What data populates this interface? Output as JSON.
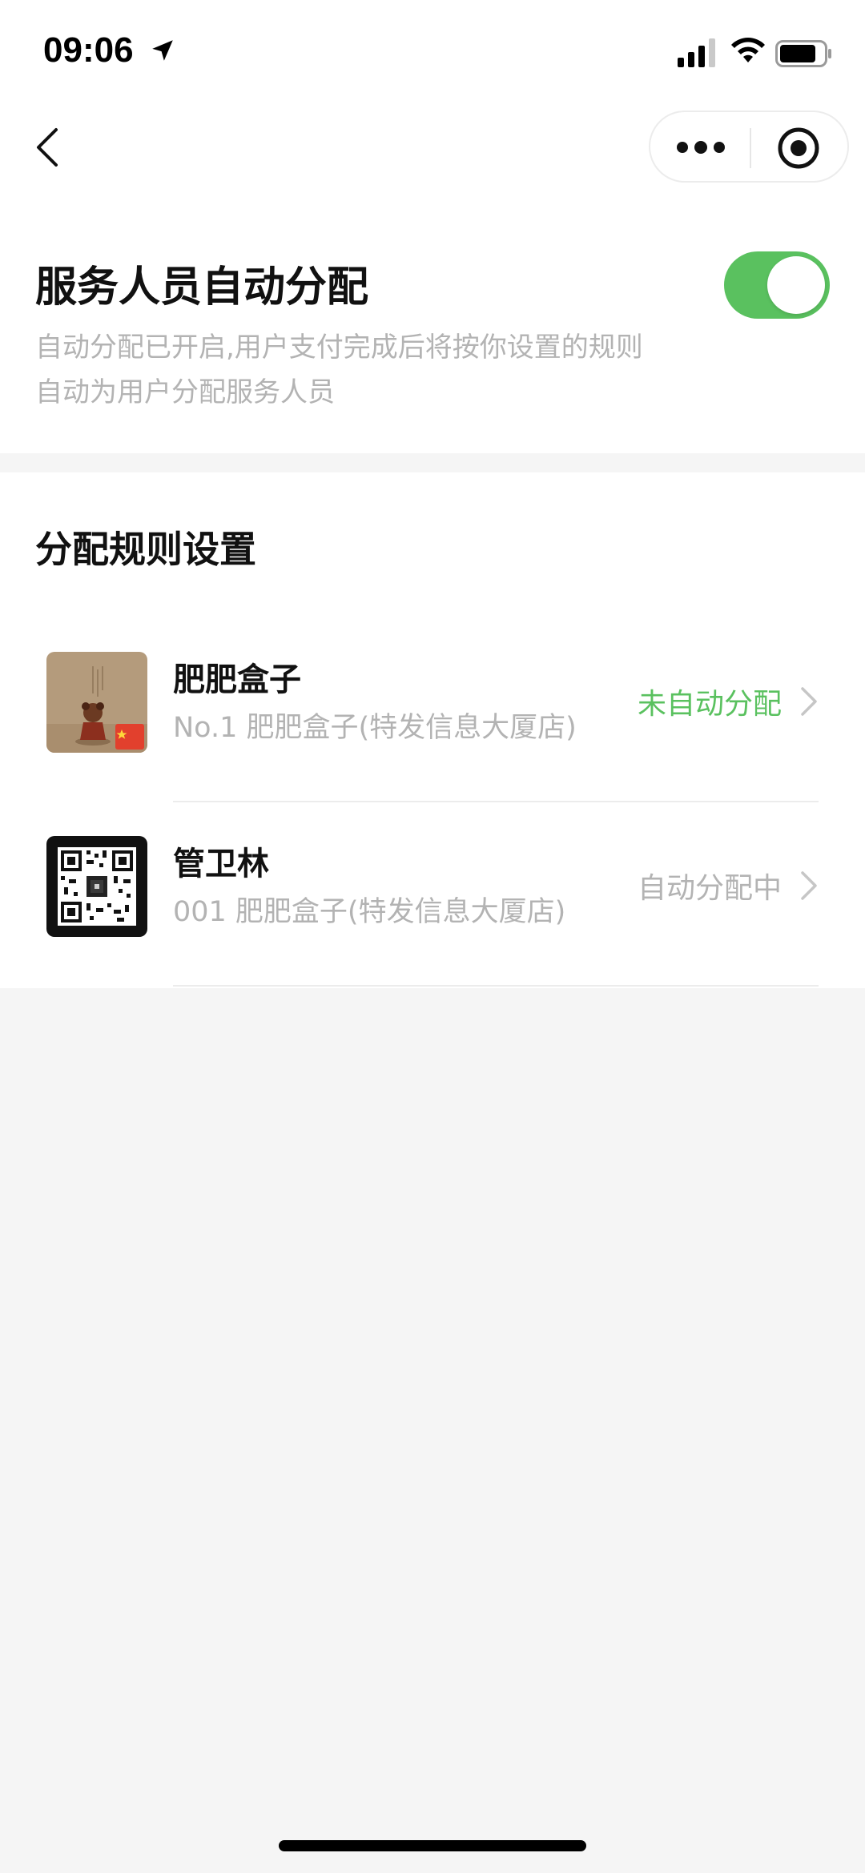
{
  "status_bar": {
    "time": "09:06",
    "icons": [
      "location-arrow-icon",
      "cellular-signal-icon",
      "wifi-icon",
      "battery-icon"
    ]
  },
  "nav": {
    "back_icon": "back-chevron-icon",
    "capsule_icons": [
      "more-dots-icon",
      "close-target-icon"
    ]
  },
  "auto_assign": {
    "title": "服务人员自动分配",
    "description": "自动分配已开启,用户支付完成后将按你设置的规则自动为用户分配服务人员",
    "toggle_on": true
  },
  "rules": {
    "title": "分配规则设置",
    "items": [
      {
        "name": "肥肥盒子",
        "store": "No.1 肥肥盒子(特发信息大厦店)",
        "status": "未自动分配",
        "status_color": "#5ac15f"
      },
      {
        "name": "管卫林",
        "store": "001 肥肥盒子(特发信息大厦店)",
        "status": "自动分配中",
        "status_color": "#b3b3b3"
      }
    ]
  },
  "colors": {
    "accent_green": "#5ac15f",
    "muted_text": "#b3b3b3",
    "background": "#f5f5f5"
  }
}
